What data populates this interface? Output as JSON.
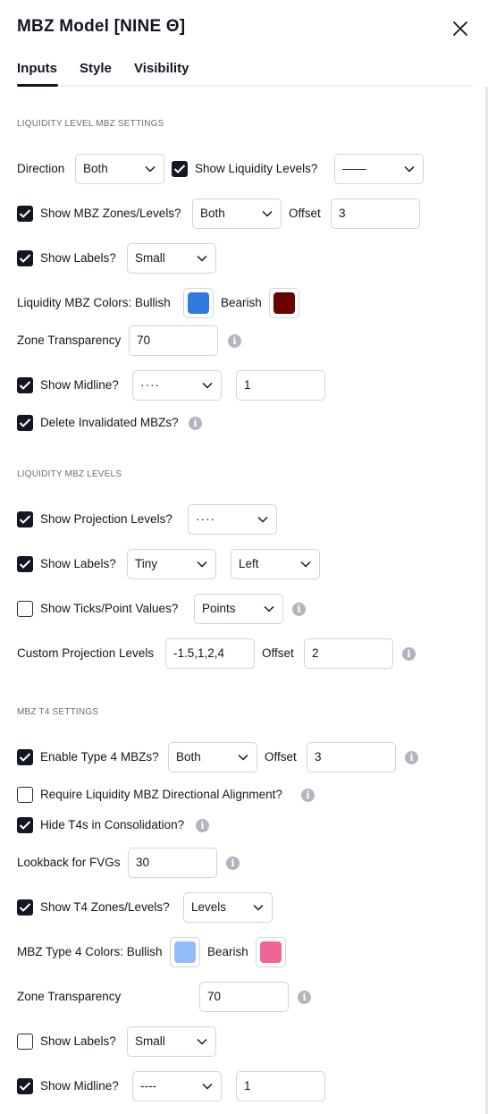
{
  "dialog": {
    "title": "MBZ Model [NINE Θ]"
  },
  "tabs": [
    {
      "label": "Inputs"
    },
    {
      "label": "Style"
    },
    {
      "label": "Visibility"
    }
  ],
  "colors": {
    "bull1": "#3178e0",
    "bear1": "#6b0000",
    "bull2": "#90bdf8",
    "bear2": "#f06595",
    "checkbox": "#131722"
  },
  "s1": {
    "header": "LIQUIDITY LEVEL MBZ SETTINGS",
    "direction_label": "Direction",
    "direction_value": "Both",
    "show_liq_label": "Show Liquidity Levels?",
    "show_liq_style": "——",
    "show_zones_label": "Show MBZ Zones/Levels?",
    "show_zones_value": "Both",
    "offset_label": "Offset",
    "offset_value": "3",
    "show_labels_label": "Show Labels?",
    "show_labels_value": "Small",
    "colors_label": "Liquidity MBZ Colors: Bullish",
    "bearish_label": "Bearish",
    "transparency_label": "Zone Transparency",
    "transparency_value": "70",
    "midline_label": "Show Midline?",
    "midline_style": "····",
    "midline_width": "1",
    "delete_label": "Delete Invalidated MBZs?"
  },
  "s2": {
    "header": "LIQUIDITY MBZ LEVELS",
    "proj_label": "Show Projection Levels?",
    "proj_style": "····",
    "labels_label": "Show Labels?",
    "labels_size": "Tiny",
    "labels_pos": "Left",
    "ticks_label": "Show Ticks/Point Values?",
    "ticks_value": "Points",
    "custom_label": "Custom Projection Levels",
    "custom_value": "-1.5,1,2,4",
    "offset_label": "Offset",
    "offset_value": "2"
  },
  "s3": {
    "header": "MBZ T4 SETTINGS",
    "enable_label": "Enable Type 4 MBZs?",
    "enable_value": "Both",
    "offset_label": "Offset",
    "offset_value": "3",
    "require_label": "Require Liquidity MBZ Directional Alignment?",
    "hide_label": "Hide T4s in Consolidation?",
    "lookback_label": "Lookback for FVGs",
    "lookback_value": "30",
    "t4zones_label": "Show T4 Zones/Levels?",
    "t4zones_value": "Levels",
    "colors_label": "MBZ Type 4 Colors: Bullish",
    "bearish_label": "Bearish",
    "transparency_label": "Zone Transparency",
    "transparency_value": "70",
    "labels_label": "Show Labels?",
    "labels_value": "Small",
    "midline_label": "Show Midline?",
    "midline_style": "----",
    "midline_width": "1"
  }
}
